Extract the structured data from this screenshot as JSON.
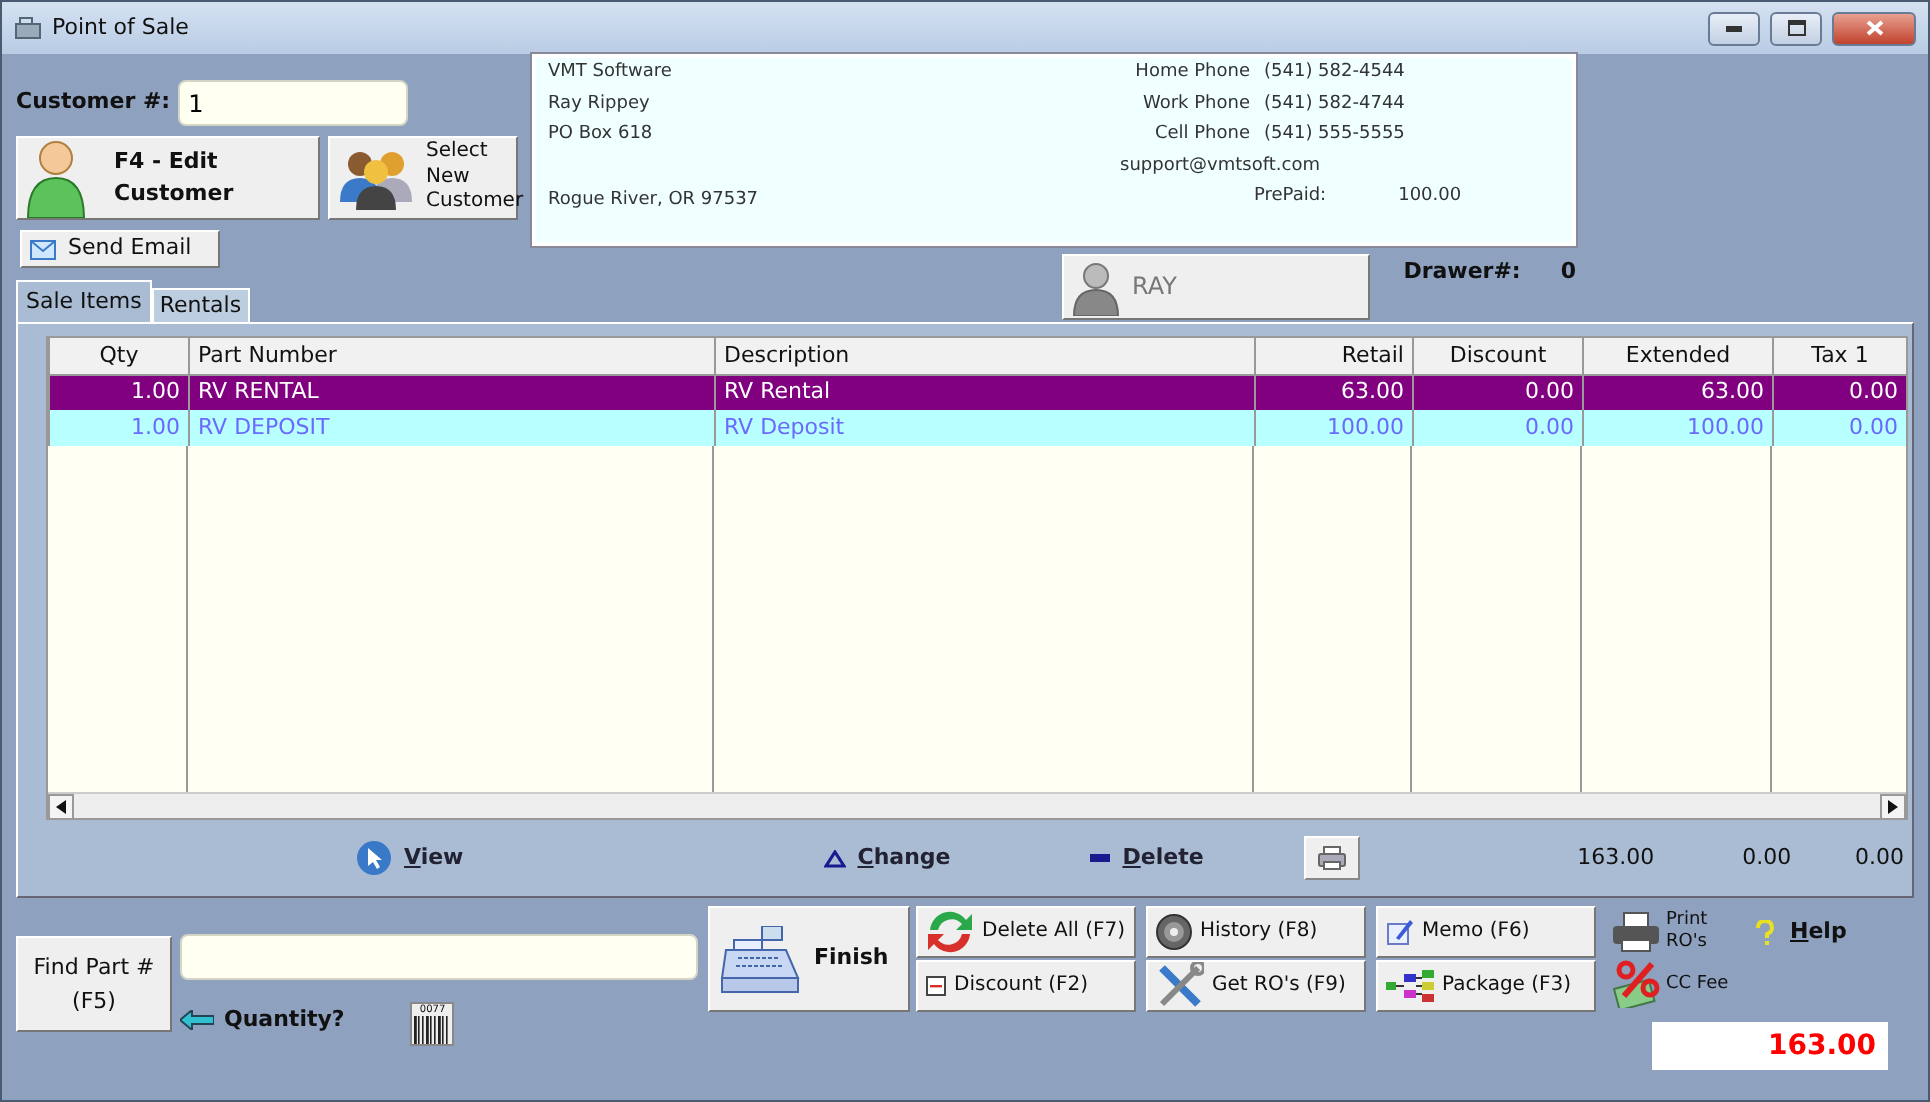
{
  "window": {
    "title": "Point of Sale"
  },
  "customer": {
    "label": "Customer #:",
    "value": "1"
  },
  "customer_buttons": [
    {
      "kind": "edit",
      "lines": [
        "F4 - Edit",
        "Customer"
      ]
    },
    {
      "kind": "select",
      "lines": [
        "Select",
        "New",
        "Customer"
      ]
    }
  ],
  "send_email": "Send Email",
  "info": {
    "lines": [
      "VMT Software",
      "Ray Rippey",
      "PO Box 618",
      "Rogue River, OR  97537"
    ],
    "phones": [
      {
        "label": "Home Phone",
        "value": "(541) 582-4544"
      },
      {
        "label": "Work Phone",
        "value": "(541) 582-4744"
      },
      {
        "label": "Cell Phone",
        "value": "(541) 555-5555"
      }
    ],
    "email": "support@vmtsoft.com",
    "prepaid": {
      "label": "PrePaid:",
      "value": "100.00"
    }
  },
  "user_button": {
    "label": "RAY",
    "disabled": true
  },
  "drawer": {
    "label": "Drawer#:",
    "value": "0"
  },
  "tabs": [
    {
      "label": "Sale Items",
      "selected": true
    },
    {
      "label": "Rentals",
      "selected": false
    }
  ],
  "table": {
    "columns": [
      "Qty",
      "Part Number",
      "Description",
      "Retail",
      "Discount",
      "Extended",
      "Tax 1"
    ],
    "rows": [
      {
        "selected": true,
        "cells": [
          "1.00",
          "RV RENTAL",
          "RV Rental",
          "63.00",
          "0.00",
          "63.00",
          "0.00"
        ]
      },
      {
        "selected": false,
        "cells": [
          "1.00",
          "RV DEPOSIT",
          "RV Deposit",
          "100.00",
          "0.00",
          "100.00",
          "0.00"
        ]
      }
    ]
  },
  "row_actions": [
    {
      "kind": "view",
      "label": "View"
    },
    {
      "kind": "change",
      "label": "Change"
    },
    {
      "kind": "delete",
      "label": "Delete"
    }
  ],
  "totals": [
    "163.00",
    "0.00",
    "0.00"
  ],
  "find_part": {
    "lines": [
      "Find Part #",
      "(F5)"
    ]
  },
  "quantity": "Quantity?",
  "barcode_caption": "0077",
  "finish": "Finish",
  "actions": [
    {
      "kind": "delete-all",
      "label": "Delete All (F7)"
    },
    {
      "kind": "history",
      "label": "History (F8)"
    },
    {
      "kind": "memo",
      "label": "Memo (F6)"
    },
    {
      "kind": "discount",
      "label": "Discount (F2)"
    },
    {
      "kind": "get-ros",
      "label": "Get RO's (F9)"
    },
    {
      "kind": "package",
      "label": "Package (F3)"
    }
  ],
  "print_ros": [
    "Print",
    "RO's"
  ],
  "help": "Help",
  "cc_fee": "CC Fee",
  "total": "163.00"
}
